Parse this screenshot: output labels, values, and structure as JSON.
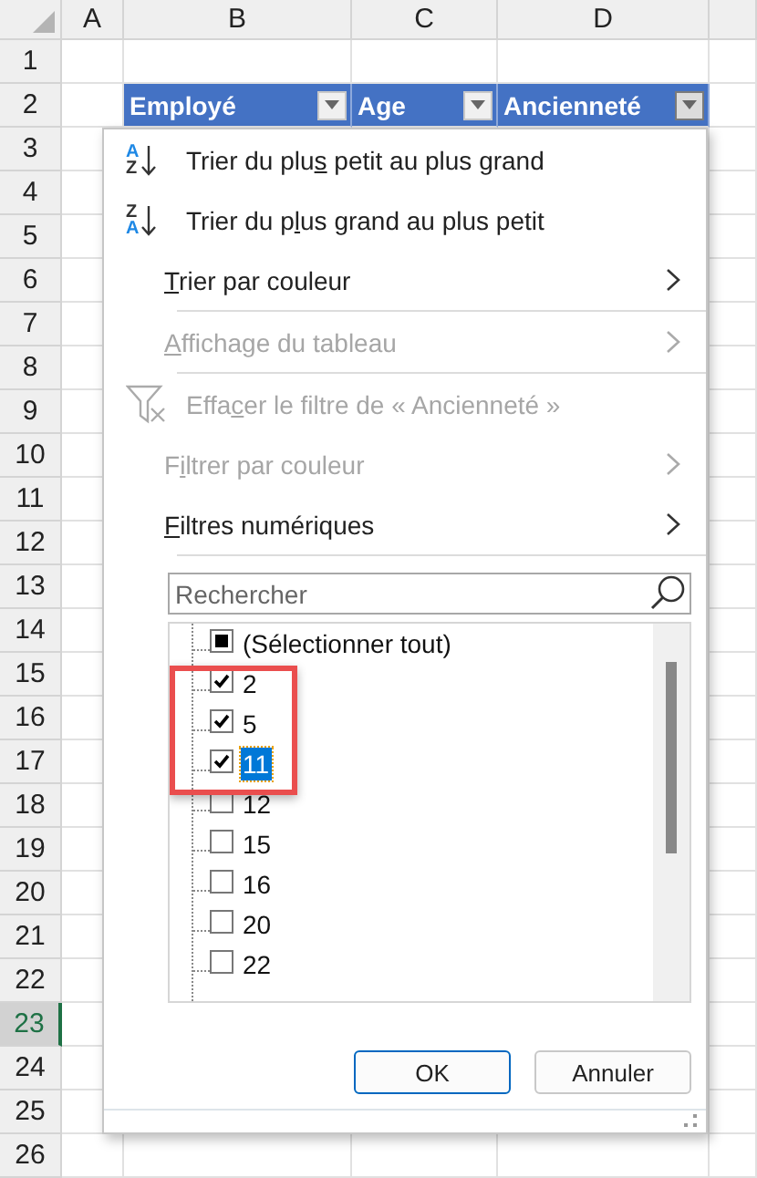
{
  "sheet": {
    "columns": [
      "A",
      "B",
      "C",
      "D"
    ],
    "rows": [
      {
        "label": "1",
        "selected": false
      },
      {
        "label": "2",
        "selected": false,
        "cells": [
          {
            "label": "Employé",
            "open": false
          },
          {
            "label": "Age",
            "open": false
          },
          {
            "label": "Ancienneté",
            "open": true
          }
        ]
      },
      {
        "label": "3",
        "selected": false
      },
      {
        "label": "4",
        "selected": false
      },
      {
        "label": "5",
        "selected": false
      },
      {
        "label": "6",
        "selected": false
      },
      {
        "label": "7",
        "selected": false
      },
      {
        "label": "8",
        "selected": false
      },
      {
        "label": "9",
        "selected": false
      },
      {
        "label": "10",
        "selected": false
      },
      {
        "label": "11",
        "selected": false
      },
      {
        "label": "12",
        "selected": false
      },
      {
        "label": "13",
        "selected": false
      },
      {
        "label": "14",
        "selected": false
      },
      {
        "label": "15",
        "selected": false
      },
      {
        "label": "16",
        "selected": false
      },
      {
        "label": "17",
        "selected": false
      },
      {
        "label": "18",
        "selected": false
      },
      {
        "label": "19",
        "selected": false
      },
      {
        "label": "20",
        "selected": false
      },
      {
        "label": "21",
        "selected": false
      },
      {
        "label": "22",
        "selected": false
      },
      {
        "label": "23",
        "selected": true
      },
      {
        "label": "24",
        "selected": false
      },
      {
        "label": "25",
        "selected": false
      },
      {
        "label": "26",
        "selected": false
      }
    ]
  },
  "filter_menu": {
    "items": [
      {
        "kind": "sort-ascending",
        "icon_top": "A",
        "icon_bottom": "Z",
        "label_before": "Trier du plu",
        "access_key": "s",
        "label_after": " petit au plus grand",
        "disabled": false,
        "separator_after": false
      },
      {
        "kind": "sort-descending",
        "icon_top": "Z",
        "icon_bottom": "A",
        "label_before": "Trier du p",
        "access_key": "l",
        "label_after": "us grand au plus petit",
        "disabled": false,
        "separator_after": false
      },
      {
        "kind": "submenu",
        "access_key": "T",
        "label_after": "rier par couleur",
        "disabled": false,
        "separator_after": true
      },
      {
        "kind": "submenu",
        "access_key": "A",
        "label_after": "ffichage du tableau",
        "disabled": true,
        "separator_after": true
      },
      {
        "kind": "clear-filter",
        "label_before": "Effa",
        "access_key": "c",
        "label_after": "er le filtre de « Ancienneté »",
        "disabled": true,
        "separator_after": false
      },
      {
        "kind": "submenu",
        "label_before": "F",
        "access_key": "i",
        "label_after": "ltrer par couleur",
        "disabled": true,
        "separator_after": false
      },
      {
        "kind": "submenu",
        "access_key": "F",
        "label_after": "iltres numériques",
        "disabled": false,
        "separator_after": true
      }
    ],
    "search": {
      "placeholder": "Rechercher"
    },
    "select_all": {
      "label": "(Sélectionner tout)",
      "indeterminate": true
    },
    "values": [
      {
        "label": "2",
        "checked": true,
        "selected": false
      },
      {
        "label": "5",
        "checked": true,
        "selected": false
      },
      {
        "label": "11",
        "checked": true,
        "selected": true
      },
      {
        "label": "12",
        "checked": false,
        "selected": false
      },
      {
        "label": "15",
        "checked": false,
        "selected": false
      },
      {
        "label": "16",
        "checked": false,
        "selected": false
      },
      {
        "label": "20",
        "checked": false,
        "selected": false
      },
      {
        "label": "22",
        "checked": false,
        "selected": false
      }
    ],
    "buttons": [
      {
        "label": "OK",
        "kind": "primary"
      },
      {
        "label": "Annuler",
        "kind": "secondary"
      }
    ]
  }
}
